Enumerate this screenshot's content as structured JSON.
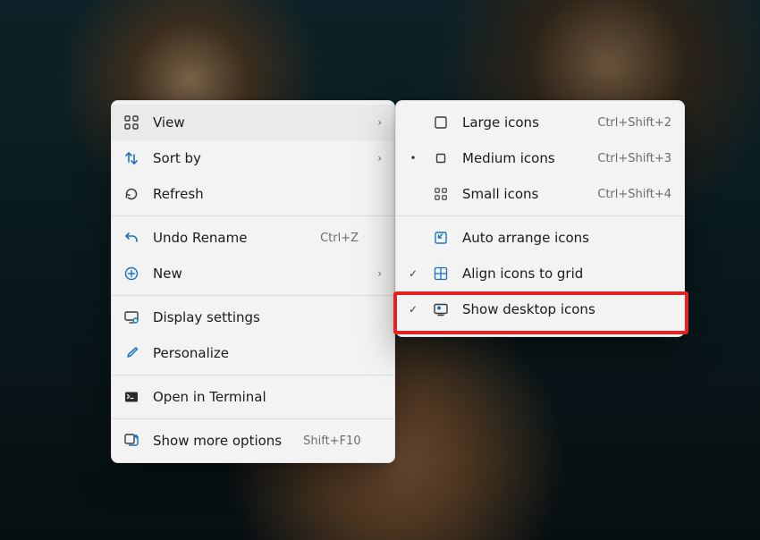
{
  "primaryMenu": {
    "view": {
      "label": "View"
    },
    "sortBy": {
      "label": "Sort by"
    },
    "refresh": {
      "label": "Refresh"
    },
    "undo": {
      "label": "Undo Rename",
      "shortcut": "Ctrl+Z"
    },
    "new": {
      "label": "New"
    },
    "display": {
      "label": "Display settings"
    },
    "personalize": {
      "label": "Personalize"
    },
    "terminal": {
      "label": "Open in Terminal"
    },
    "moreOptions": {
      "label": "Show more options",
      "shortcut": "Shift+F10"
    }
  },
  "viewSubmenu": {
    "large": {
      "label": "Large icons",
      "shortcut": "Ctrl+Shift+2"
    },
    "medium": {
      "label": "Medium icons",
      "shortcut": "Ctrl+Shift+3",
      "selected": true
    },
    "small": {
      "label": "Small icons",
      "shortcut": "Ctrl+Shift+4"
    },
    "autoArrange": {
      "label": "Auto arrange icons",
      "checked": false
    },
    "alignGrid": {
      "label": "Align icons to grid",
      "checked": true
    },
    "showIcons": {
      "label": "Show desktop icons",
      "checked": true,
      "highlighted": true
    }
  },
  "glyphs": {
    "chevronRight": "›",
    "checkmark": "✓",
    "bullet": "•"
  }
}
